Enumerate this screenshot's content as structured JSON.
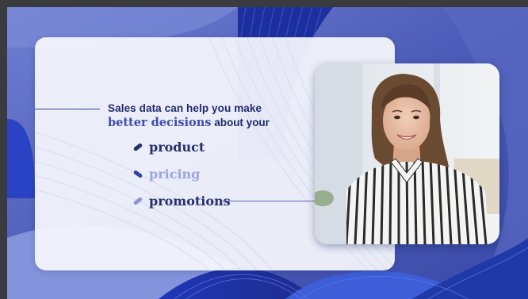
{
  "slide": {
    "headline_line1": "Sales data can help you make",
    "headline_accent": "better decisions",
    "headline_tail": " about your",
    "items": [
      {
        "label": "product",
        "icon": "pill-bullet-icon"
      },
      {
        "label": "pricing",
        "icon": "pill-bullet-icon"
      },
      {
        "label": "promotions",
        "icon": "pill-bullet-icon"
      }
    ],
    "photo": {
      "subject": "smiling-woman-photo"
    }
  },
  "colors": {
    "navy": "#1f2a6e",
    "accent_blue": "#3d4db3",
    "muted_blue": "#9aa6e2",
    "background_blue": "#4b5bb8",
    "card": "#f6f8fd"
  }
}
